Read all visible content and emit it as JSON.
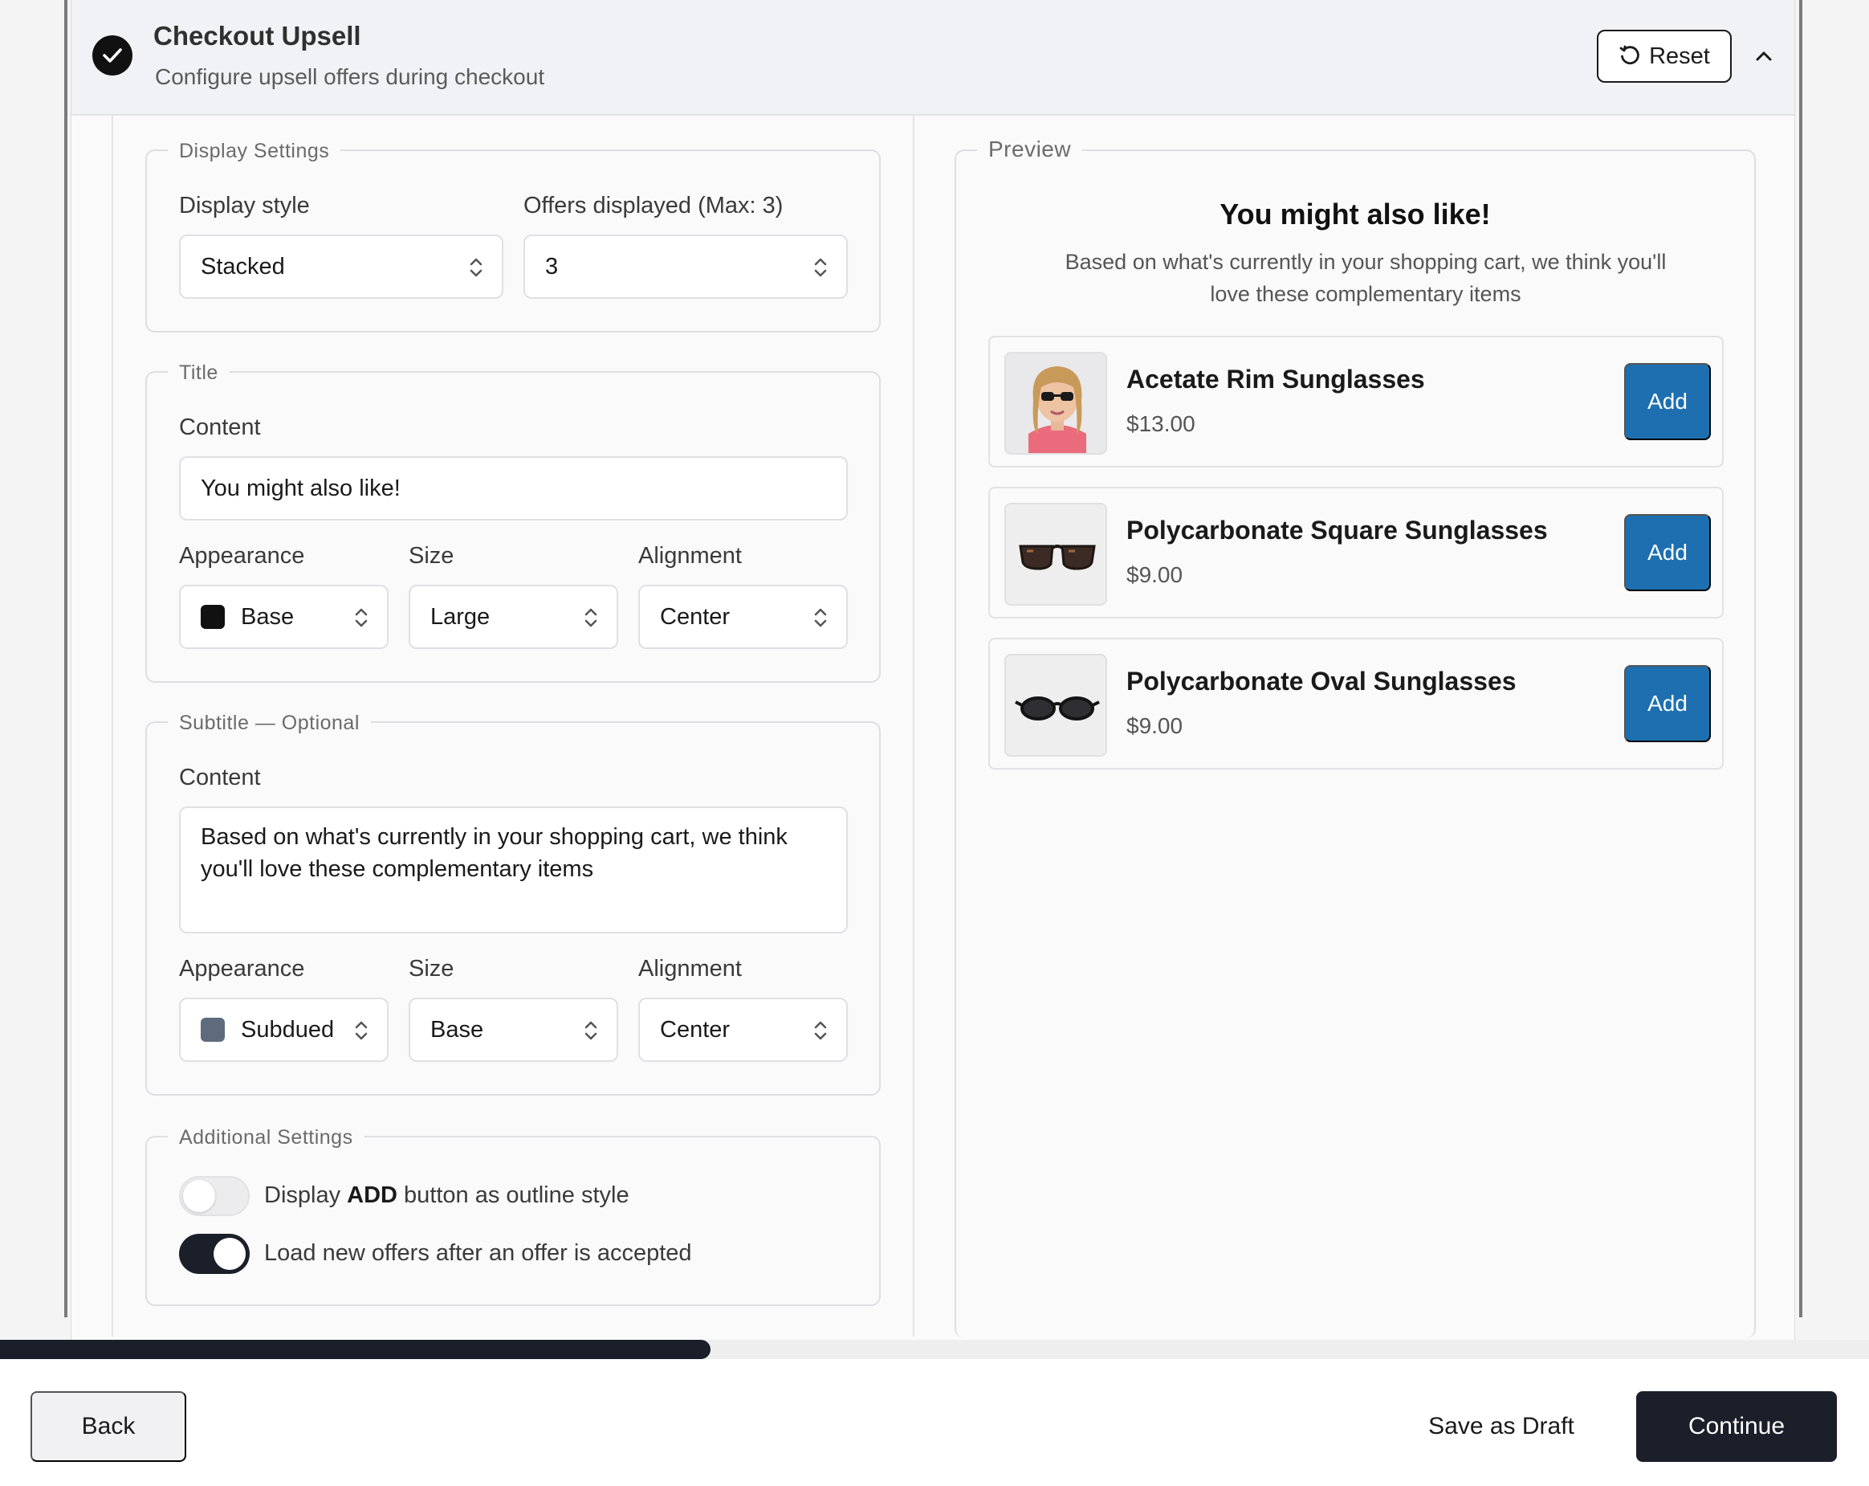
{
  "header": {
    "title": "Checkout Upsell",
    "subtitle": "Configure upsell offers during checkout",
    "reset_label": "Reset"
  },
  "display_settings": {
    "legend": "Display Settings",
    "style_label": "Display style",
    "style_value": "Stacked",
    "offers_label": "Offers displayed (Max: 3)",
    "offers_value": "3"
  },
  "title_section": {
    "legend": "Title",
    "content_label": "Content",
    "content_value": "You might also like!",
    "appearance_label": "Appearance",
    "appearance_value": "Base",
    "appearance_color": "#111111",
    "size_label": "Size",
    "size_value": "Large",
    "alignment_label": "Alignment",
    "alignment_value": "Center"
  },
  "subtitle_section": {
    "legend": "Subtitle — Optional",
    "content_label": "Content",
    "content_value": "Based on what's currently in your shopping cart, we think you'll love these complementary items",
    "appearance_label": "Appearance",
    "appearance_value": "Subdued",
    "appearance_color": "#5f6b7d",
    "size_label": "Size",
    "size_value": "Base",
    "alignment_label": "Alignment",
    "alignment_value": "Center"
  },
  "additional_settings": {
    "legend": "Additional Settings",
    "outline_prefix": "Display ",
    "outline_bold": "ADD",
    "outline_suffix": " button as outline style",
    "outline_enabled": false,
    "load_new_label": "Load new offers after an offer is accepted",
    "load_new_enabled": true
  },
  "preview": {
    "legend": "Preview",
    "title": "You might also like!",
    "subtitle": "Based on what's currently in your shopping cart, we think you'll love these complementary items",
    "products": [
      {
        "name": "Acetate Rim Sunglasses",
        "price": "$13.00",
        "add_label": "Add",
        "image": "woman-with-sunglasses"
      },
      {
        "name": "Polycarbonate Square Sunglasses",
        "price": "$9.00",
        "add_label": "Add",
        "image": "square-sunglasses"
      },
      {
        "name": "Polycarbonate Oval Sunglasses",
        "price": "$9.00",
        "add_label": "Add",
        "image": "oval-sunglasses"
      }
    ]
  },
  "progress": {
    "fraction": 0.38
  },
  "footer": {
    "back_label": "Back",
    "draft_label": "Save as Draft",
    "continue_label": "Continue"
  },
  "colors": {
    "primary_dark": "#1b1f2a",
    "add_button": "#1e6fb0"
  }
}
